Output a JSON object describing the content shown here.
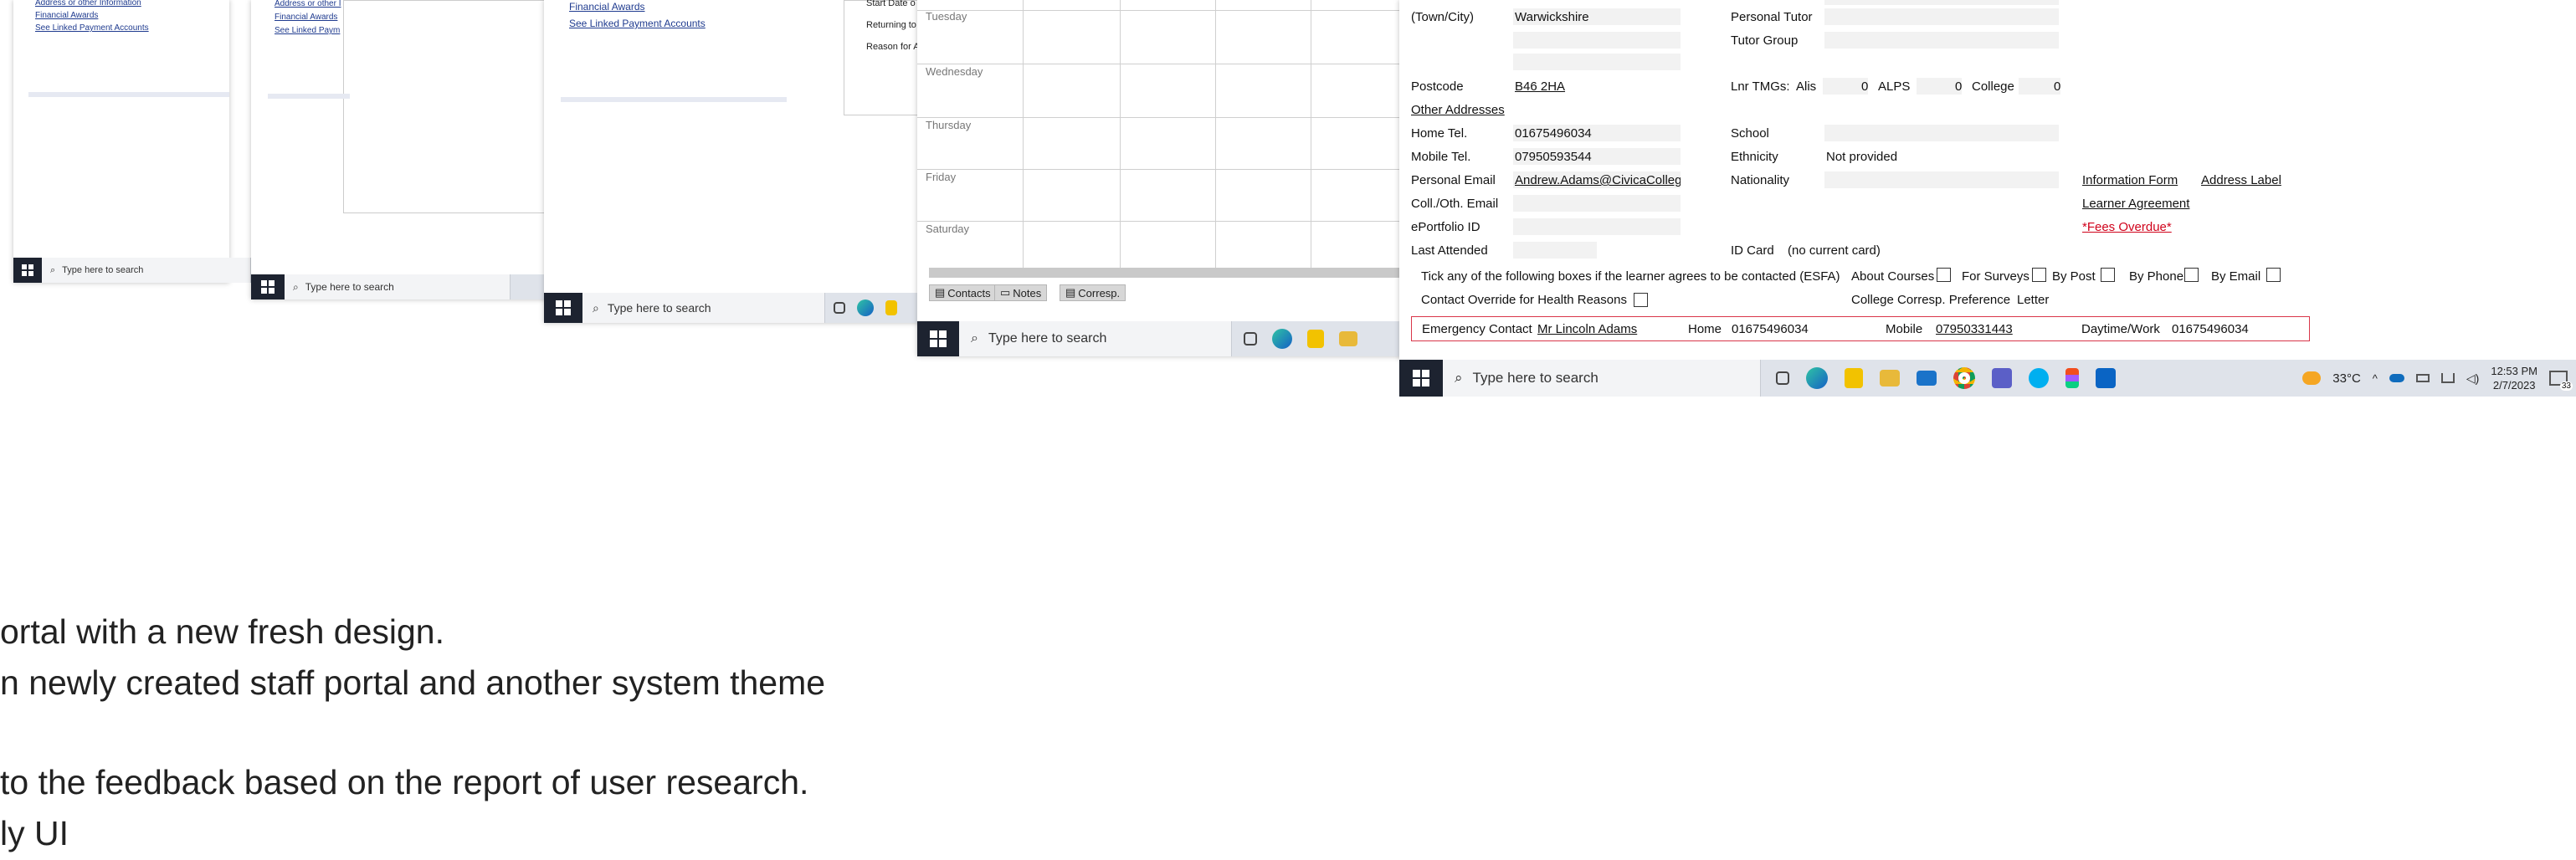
{
  "win1": {
    "links": [
      "Address or other Information",
      "Financial Awards",
      "See Linked Payment Accounts"
    ],
    "search_placeholder": "Type here to search"
  },
  "win2": {
    "links": [
      "Address or other I",
      "Financial Awards",
      "See Linked Paym"
    ],
    "search_placeholder": "Type here to search"
  },
  "win3": {
    "links": [
      "Financial Awards",
      "See Linked Payment Accounts"
    ],
    "search_placeholder": "Type here to search",
    "side_text": [
      "Start Date o",
      "Returning to",
      "Reason for A"
    ]
  },
  "win4": {
    "days": [
      "Tuesday",
      "Wednesday",
      "Thursday",
      "Friday",
      "Saturday"
    ],
    "tabs": [
      "Contacts",
      "Notes",
      "Corresp."
    ],
    "search_placeholder": "Type here to search"
  },
  "main": {
    "town_label": "(Town/City)",
    "town_value": "Warwickshire",
    "personal_tutor_label": "Personal Tutor",
    "tutor_group_label": "Tutor Group",
    "postcode_label": "Postcode",
    "postcode_value": "B46 2HA",
    "lnr_tmgs_label": "Lnr TMGs:",
    "alis_label": "Alis",
    "alis_value": "0",
    "alps_label": "ALPS",
    "alps_value": "0",
    "college_label": "College",
    "college_value": "0",
    "other_addresses": "Other Addresses",
    "home_tel_label": "Home Tel.",
    "home_tel_value": "01675496034",
    "school_label": "School",
    "mobile_tel_label": "Mobile Tel.",
    "mobile_tel_value": "07950593544",
    "ethnicity_label": "Ethnicity",
    "ethnicity_value": "Not provided",
    "personal_email_label": "Personal Email",
    "personal_email_value": "Andrew.Adams@CivicaCollege",
    "nationality_label": "Nationality",
    "information_form": "Information Form",
    "address_label_link": "Address Label",
    "coll_email_label": "Coll./Oth. Email",
    "learner_agreement": "Learner Agreement",
    "eportfolio_label": "ePortfolio ID",
    "fees_overdue": "*Fees Overdue*",
    "last_attended_label": "Last Attended",
    "id_card_label": "ID Card",
    "id_card_value": "(no current card)",
    "consent_text": "Tick any of the following boxes if the learner agrees to be contacted (ESFA)",
    "about_courses": "About Courses",
    "for_surveys": "For Surveys",
    "by_post": "By Post",
    "by_phone": "By Phone",
    "by_email": "By Email",
    "contact_override": "Contact Override for Health Reasons",
    "corresp_pref_label": "College Corresp. Preference",
    "corresp_pref_value": "Letter",
    "emergency_label": "Emergency Contact",
    "emergency_name": "Mr Lincoln Adams",
    "em_home_label": "Home",
    "em_home_value": "01675496034",
    "em_mobile_label": "Mobile",
    "em_mobile_value": "07950331443",
    "em_day_label": "Daytime/Work",
    "em_day_value": "01675496034"
  },
  "taskbar": {
    "search_placeholder": "Type here to search",
    "temperature": "33°C",
    "time": "12:53 PM",
    "date": "2/7/2023",
    "notification_count": "33"
  },
  "slide_text": [
    "ortal with a new fresh design.",
    "n newly created staff portal  and another system theme",
    "to the feedback based on the report of user research.",
    "ly UI"
  ],
  "colors": {
    "taskbar_bg": "#dfe3ea",
    "start_bg": "#1d2330",
    "link": "#1f3b8f",
    "fees_overdue": "#d0021b",
    "emergency_border": "#d9364a"
  }
}
